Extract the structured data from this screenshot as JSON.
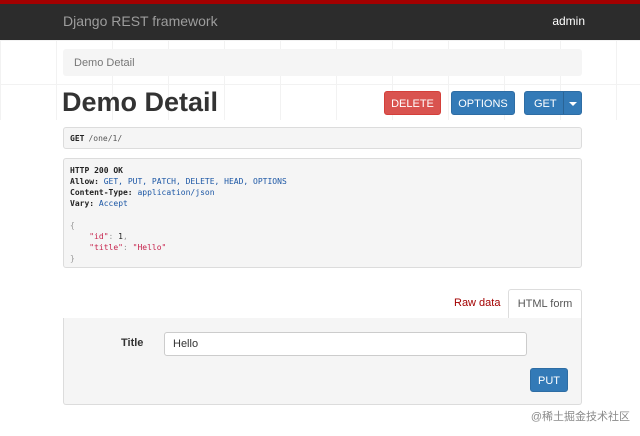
{
  "navbar": {
    "brand": "Django REST framework",
    "user": "admin"
  },
  "breadcrumb": {
    "item": "Demo Detail"
  },
  "page": {
    "title": "Demo Detail"
  },
  "actions": {
    "delete": "DELETE",
    "options": "OPTIONS",
    "get": "GET"
  },
  "request": {
    "method": "GET",
    "path": "/one/1/"
  },
  "response": {
    "status": "HTTP 200 OK",
    "allow_label": "Allow:",
    "allow_value": "GET, PUT, PATCH, DELETE, HEAD, OPTIONS",
    "content_type_label": "Content-Type:",
    "content_type_value": "application/json",
    "vary_label": "Vary:",
    "vary_value": "Accept",
    "body": {
      "open_brace": "{",
      "id_key": "\"id\"",
      "id_value": "1",
      "title_key": "\"title\"",
      "title_value": "\"Hello\"",
      "close_brace": "}"
    }
  },
  "tabs": {
    "raw": "Raw data",
    "html": "HTML form"
  },
  "form": {
    "title_label": "Title",
    "title_value": "Hello",
    "submit": "PUT"
  },
  "watermark": "@稀土掘金技术社区",
  "colors": {
    "navbar_bg": "#2c2c2c",
    "accent": "#a30000",
    "primary": "#337ab7",
    "danger": "#d9534f"
  }
}
